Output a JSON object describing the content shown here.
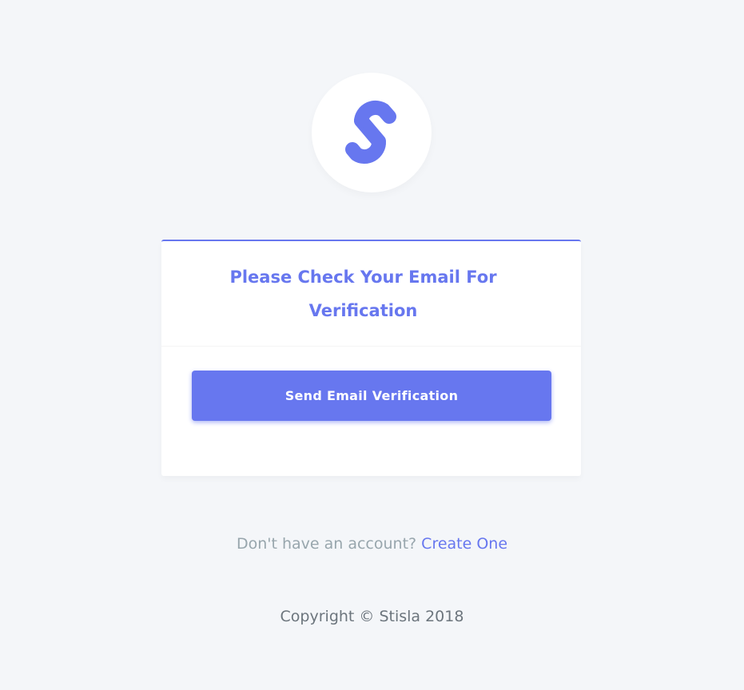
{
  "brand": {
    "logo_icon": "stisla-s-logo",
    "accent_color": "#6777ef"
  },
  "card": {
    "title": "Please Check Your Email For Verification",
    "button_label": "Send Email Verification"
  },
  "signup": {
    "prompt": "Don't have an account?",
    "link_label": "Create One"
  },
  "footer": {
    "copyright": "Copyright © Stisla 2018"
  }
}
